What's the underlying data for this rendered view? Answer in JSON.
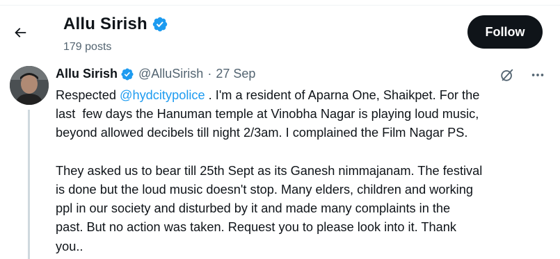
{
  "header": {
    "name": "Allu Sirish",
    "posts": "179 posts",
    "follow_label": "Follow"
  },
  "tweet": {
    "name": "Allu Sirish",
    "handle": "@AlluSirish",
    "separator": "·",
    "date": "27 Sep",
    "para1_before": "Respected ",
    "mention": "@hydcitypolice",
    "para1_line1_after": " . I'm a resident of Aparna One, Shaikpet. For the",
    "para1_line2": "last  few days the Hanuman temple at Vinobha Nagar is playing loud music,",
    "para1_line3": "beyond allowed decibels till night 2/3am. I complained the Film Nagar PS.",
    "para2_line1": "They asked us to bear till 25th Sept as its Ganesh nimmajanam. The festival",
    "para2_line2": "is done but the loud music doesn't stop. Many elders, children and working",
    "para2_line3": "ppl in our society and disturbed by it and made many complaints in the",
    "para2_line4": "past. But no action was taken. Request you to please look into it. Thank",
    "para2_line5": "you.."
  },
  "icons": {
    "back": "arrow-left-icon",
    "verified": "verified-badge-icon",
    "grok": "grok-icon",
    "more": "more-dots-icon"
  },
  "colors": {
    "verified": "#1d9bf0",
    "link": "#1d9bf0",
    "follow_bg": "#0f1419",
    "muted": "#536471"
  }
}
